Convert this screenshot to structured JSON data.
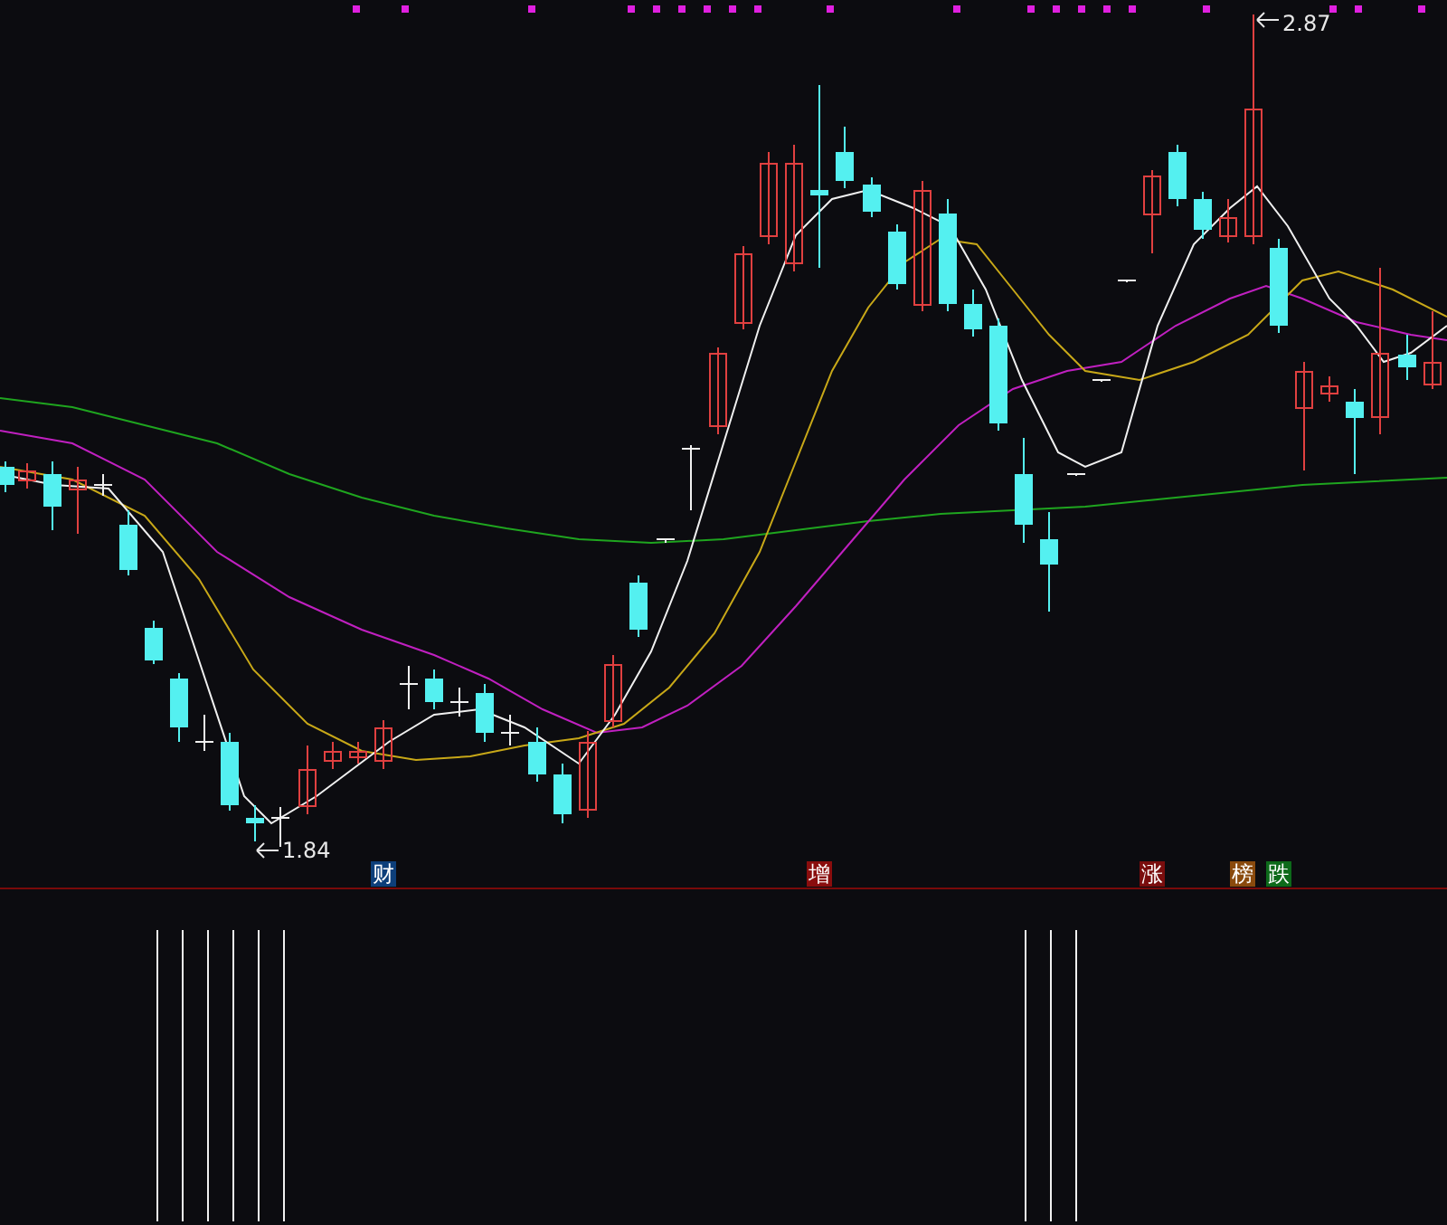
{
  "price_chart": {
    "high_label": "2.87",
    "low_label": "1.84"
  },
  "event_markers": [
    {
      "text": "财",
      "color": "#0d3f7a"
    },
    {
      "text": "增",
      "color": "#8a0d0d"
    },
    {
      "text": "涨",
      "color": "#7a0d0d"
    },
    {
      "text": "榜",
      "color": "#8a4a0d"
    },
    {
      "text": "跌",
      "color": "#0d6a1a"
    }
  ]
}
